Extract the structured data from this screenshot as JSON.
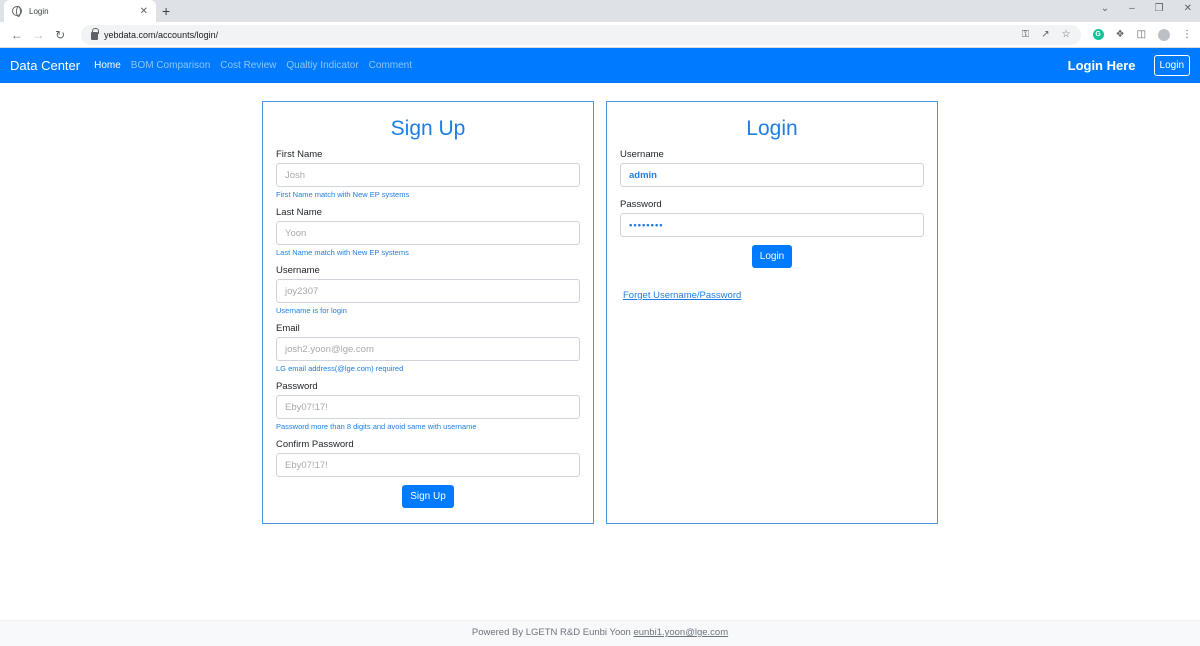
{
  "browser": {
    "tab_title": "Login",
    "tab_close": "✕",
    "new_tab": "+",
    "url": "yebdata.com/accounts/login/",
    "window_controls": [
      "⌄",
      "–",
      "❐",
      "✕"
    ]
  },
  "navbar": {
    "brand": "Data Center",
    "links": [
      "Home",
      "BOM Comparison",
      "Cost Review",
      "Qualtiy Indicator",
      "Comment"
    ],
    "login_here": "Login Here",
    "login_button": "Login"
  },
  "signup": {
    "title": "Sign Up",
    "fields": [
      {
        "label": "First Name",
        "placeholder": "Josh",
        "help": "First Name match with New EP systems"
      },
      {
        "label": "Last Name",
        "placeholder": "Yoon",
        "help": "Last Name match with New EP systems"
      },
      {
        "label": "Username",
        "placeholder": "joy2307",
        "help": "Username is for login"
      },
      {
        "label": "Email",
        "placeholder": "josh2.yoon@lge.com",
        "help": "LG email address(@lge.com) required"
      },
      {
        "label": "Password",
        "placeholder": "Eby07!17!",
        "help": "Password more than 8 digits and avoid same with username"
      },
      {
        "label": "Confirm Password",
        "placeholder": "Eby07!17!",
        "help": ""
      }
    ],
    "submit": "Sign Up"
  },
  "login": {
    "title": "Login",
    "username_label": "Username",
    "username_value": "admin",
    "password_label": "Password",
    "password_value": "••••••••",
    "submit": "Login",
    "forget": "Forget Username/Password"
  },
  "footer": {
    "text": "Powered By LGETN R&D Eunbi Yoon",
    "email": "eunbi1.yoon@lge.com"
  }
}
